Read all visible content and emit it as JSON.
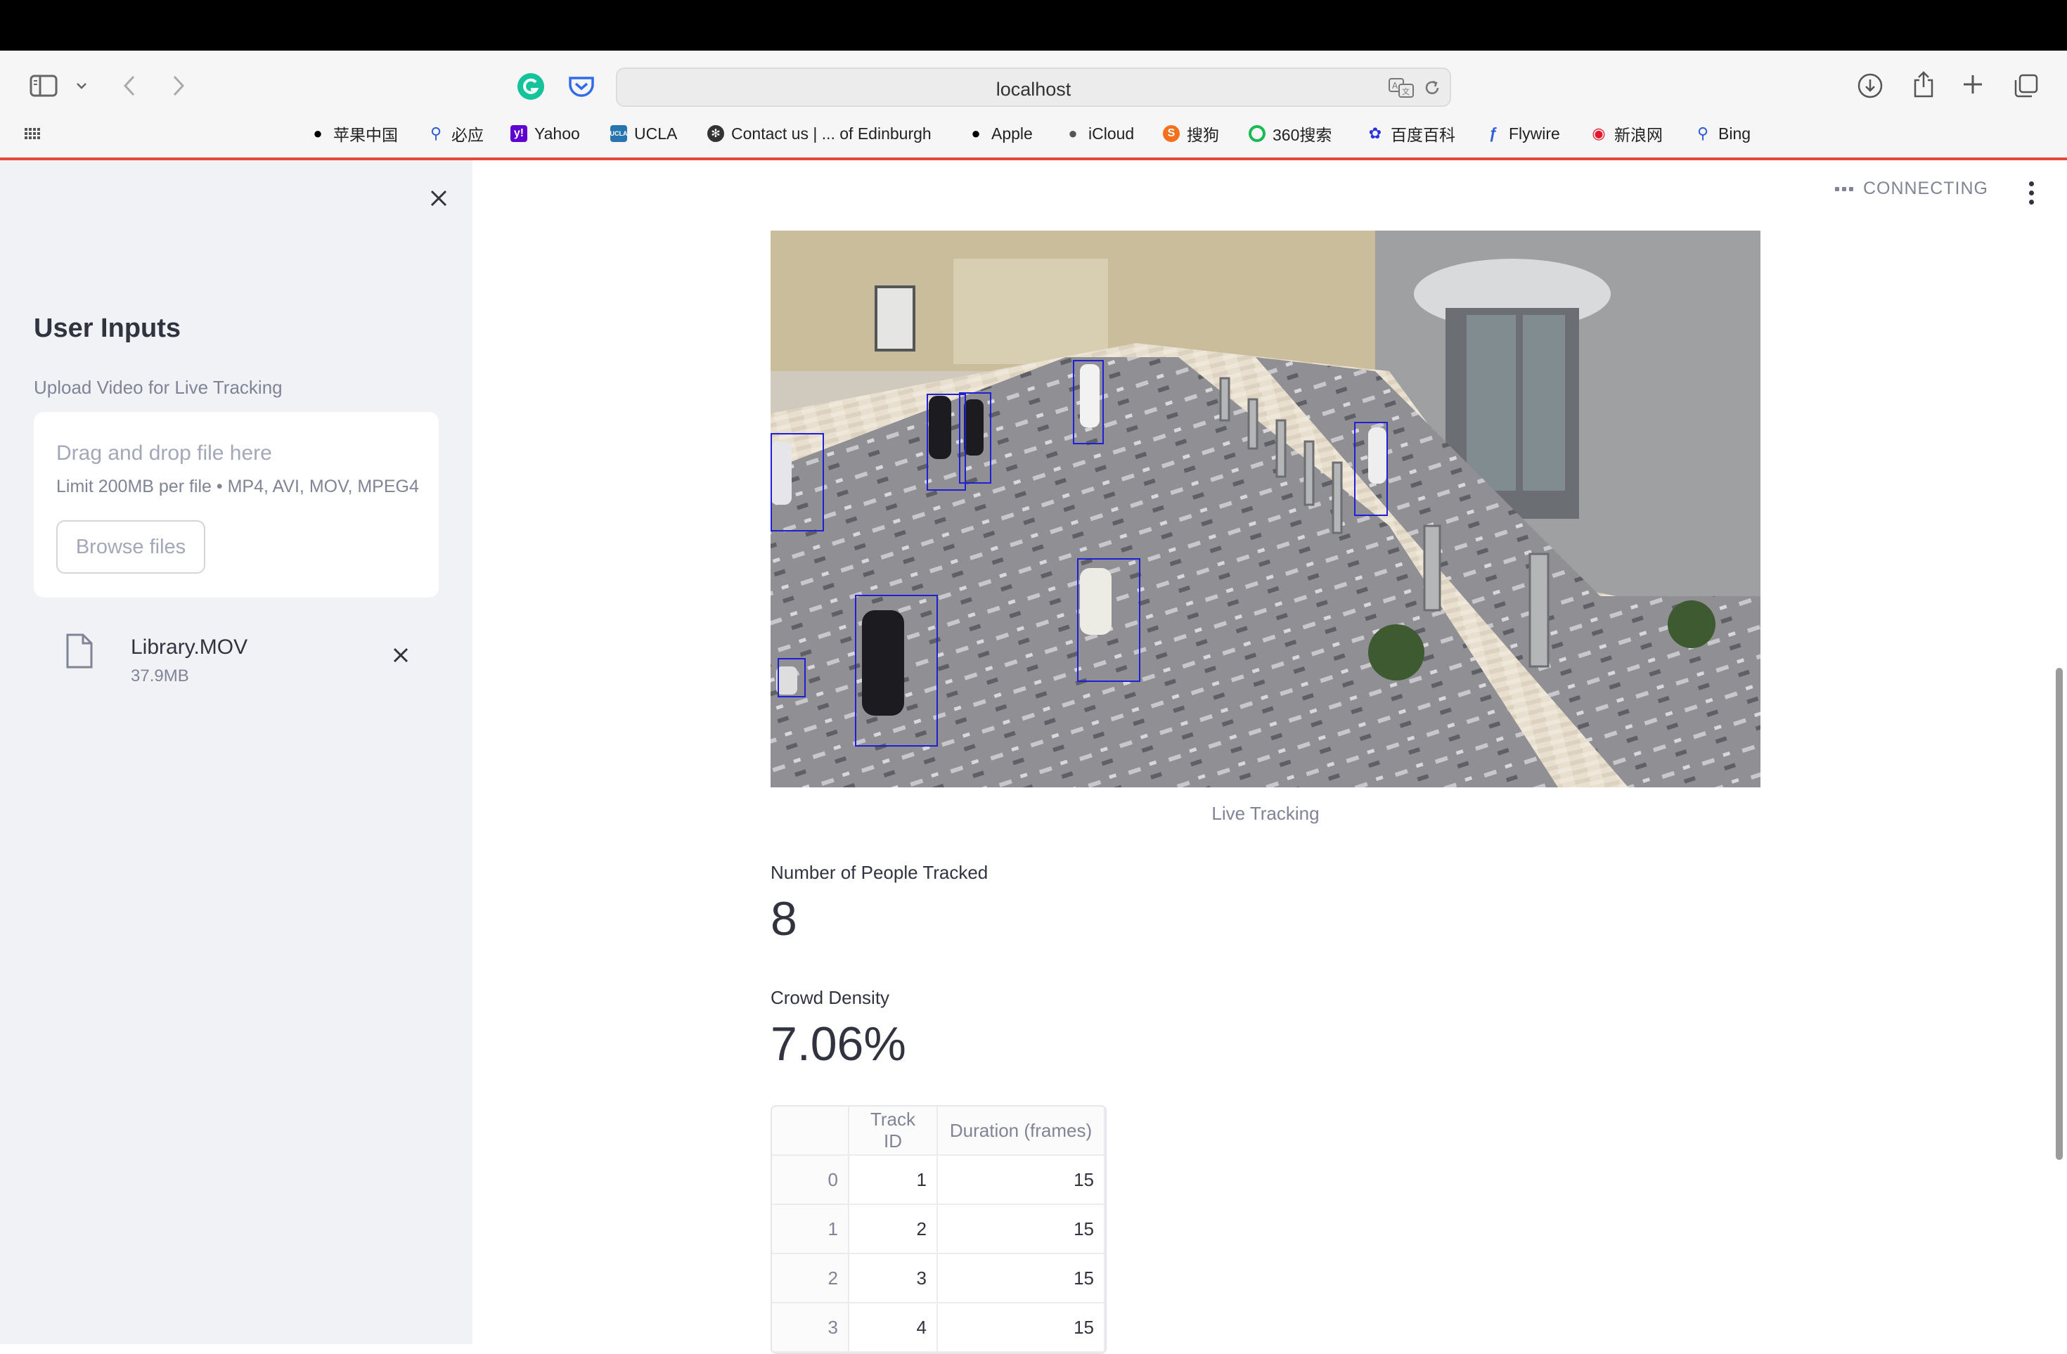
{
  "browser": {
    "url": "localhost",
    "bookmarks": [
      {
        "label": "苹果中国",
        "icon": "apple-icon",
        "color": "#000000"
      },
      {
        "label": "必应",
        "icon": "search-icon",
        "color": "#2b5bd7"
      },
      {
        "label": "Yahoo",
        "icon": "yahoo-icon",
        "color": "#5f01d1"
      },
      {
        "label": "UCLA",
        "icon": "ucla-icon",
        "color": "#2774ae"
      },
      {
        "label": "Contact us | ... of Edinburgh",
        "icon": "edinburgh-icon",
        "color": "#333333"
      },
      {
        "label": "Apple",
        "icon": "apple-icon",
        "color": "#000000"
      },
      {
        "label": "iCloud",
        "icon": "apple-icon",
        "color": "#555555"
      },
      {
        "label": "搜狗",
        "icon": "sogou-icon",
        "color": "#f4701c"
      },
      {
        "label": "360搜索",
        "icon": "360-icon",
        "color": "#19b955"
      },
      {
        "label": "百度百科",
        "icon": "baidu-icon",
        "color": "#2932e1"
      },
      {
        "label": "Flywire",
        "icon": "flywire-icon",
        "color": "#2f5fd8"
      },
      {
        "label": "新浪网",
        "icon": "sina-icon",
        "color": "#e6162d"
      },
      {
        "label": "Bing",
        "icon": "search-icon",
        "color": "#2b5bd7"
      }
    ]
  },
  "sidebar": {
    "title": "User Inputs",
    "upload_label": "Upload Video for Live Tracking",
    "dropzone_title": "Drag and drop file here",
    "dropzone_limit": "Limit 200MB per file • MP4, AVI, MOV, MPEG4",
    "browse_label": "Browse files",
    "file": {
      "name": "Library.MOV",
      "size": "37.9MB"
    }
  },
  "main": {
    "status": "CONNECTING",
    "video_caption": "Live Tracking",
    "metrics": [
      {
        "label": "Number of People Tracked",
        "value": "8"
      },
      {
        "label": "Crowd Density",
        "value": "7.06%"
      }
    ],
    "table": {
      "headers": [
        "",
        "Track ID",
        "Duration (frames)"
      ],
      "rows": [
        [
          "0",
          "1",
          "15"
        ],
        [
          "1",
          "2",
          "15"
        ],
        [
          "2",
          "3",
          "15"
        ],
        [
          "3",
          "4",
          "15"
        ]
      ]
    }
  },
  "colors": {
    "accent": "#e44b3c",
    "tracking_box": "#1f1fd6",
    "sidebar_bg": "#f0f2f6"
  }
}
